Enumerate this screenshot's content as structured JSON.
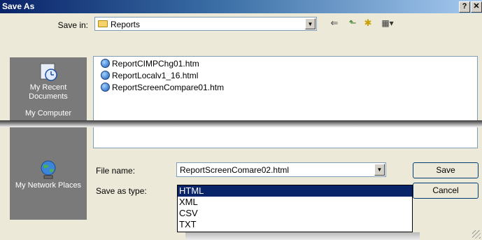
{
  "window": {
    "title": "Save As",
    "help_glyph": "?",
    "close_glyph": "✕"
  },
  "save_in": {
    "label": "Save in:",
    "value": "Reports",
    "arrow": "▼"
  },
  "toolbar": {
    "back_glyph": "⇐",
    "up_glyph": "⬑",
    "new_folder_glyph": "✱",
    "views_glyph": "▦▾"
  },
  "places": [
    {
      "label": "My Recent Documents",
      "icon": "clock-icon"
    },
    {
      "label": "My Computer",
      "icon": "computer-icon"
    },
    {
      "label": "My Network Places",
      "icon": "globe-icon"
    }
  ],
  "files": [
    "ReportCIMPChg01.htm",
    "ReportLocalv1_16.html",
    "ReportScreenCompare01.htm"
  ],
  "file_name": {
    "label": "File name:",
    "value": "ReportScreenComare02.html",
    "arrow": "▼"
  },
  "save_as_type": {
    "label": "Save as type:",
    "options": [
      "HTML",
      "XML",
      "CSV",
      "TXT"
    ],
    "selected": "HTML"
  },
  "buttons": {
    "save": "Save",
    "cancel": "Cancel"
  }
}
